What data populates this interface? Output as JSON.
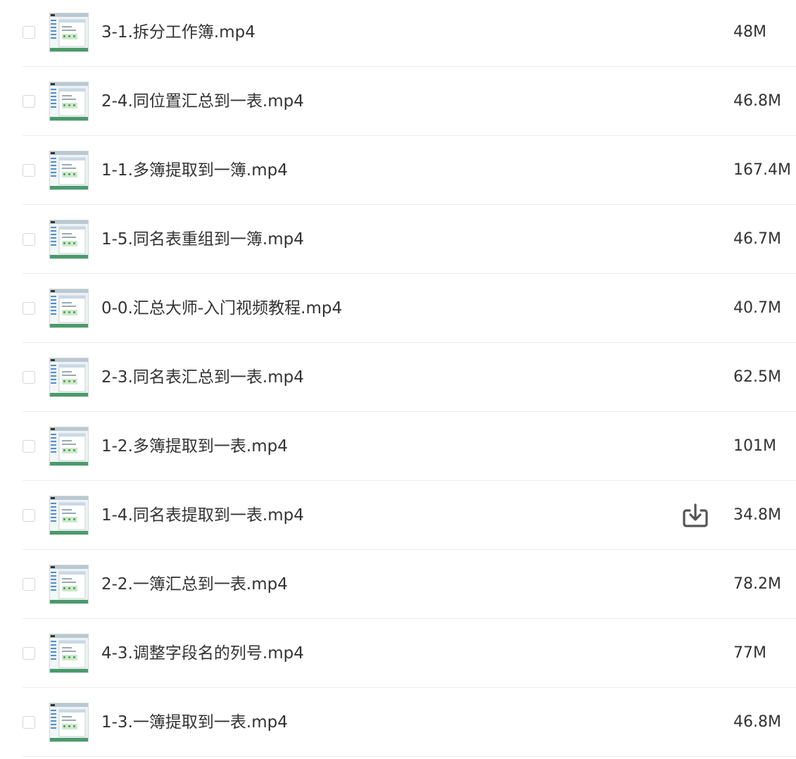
{
  "files": [
    {
      "name": "3-1.拆分工作簿.mp4",
      "size": "48M"
    },
    {
      "name": "2-4.同位置汇总到一表.mp4",
      "size": "46.8M"
    },
    {
      "name": "1-1.多簿提取到一簿.mp4",
      "size": "167.4M"
    },
    {
      "name": "1-5.同名表重组到一簿.mp4",
      "size": "46.7M"
    },
    {
      "name": "0-0.汇总大师-入门视频教程.mp4",
      "size": "40.7M"
    },
    {
      "name": "2-3.同名表汇总到一表.mp4",
      "size": "62.5M"
    },
    {
      "name": "1-2.多簿提取到一表.mp4",
      "size": "101M"
    },
    {
      "name": "1-4.同名表提取到一表.mp4",
      "size": "34.8M"
    },
    {
      "name": "2-2.一簿汇总到一表.mp4",
      "size": "78.2M"
    },
    {
      "name": "4-3.调整字段名的列号.mp4",
      "size": "77M"
    },
    {
      "name": "1-3.一簿提取到一表.mp4",
      "size": "46.8M"
    }
  ],
  "hover_row_index": 7,
  "icons": {
    "download": "download-icon",
    "thumbnail": "video-thumbnail"
  },
  "colors": {
    "text": "#333333",
    "divider": "#eeeeee",
    "checkbox_border": "#d6d6d6",
    "icon": "#555555"
  }
}
